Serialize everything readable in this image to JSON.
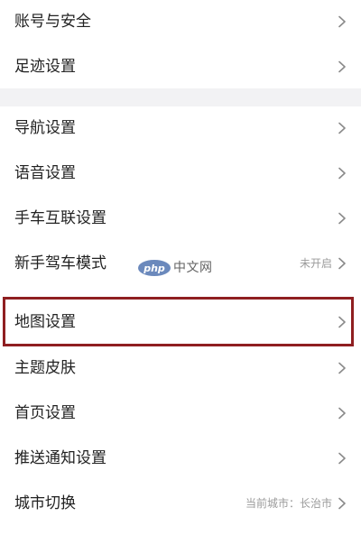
{
  "settings": {
    "group1": [
      {
        "label": "账号与安全",
        "value": ""
      },
      {
        "label": "足迹设置",
        "value": ""
      }
    ],
    "group2": [
      {
        "label": "导航设置",
        "value": ""
      },
      {
        "label": "语音设置",
        "value": ""
      },
      {
        "label": "手车互联设置",
        "value": ""
      },
      {
        "label": "新手驾车模式",
        "value": "未开启"
      },
      {
        "label": "地图设置",
        "value": ""
      },
      {
        "label": "主题皮肤",
        "value": ""
      },
      {
        "label": "首页设置",
        "value": ""
      },
      {
        "label": "推送通知设置",
        "value": ""
      },
      {
        "label": "城市切换",
        "value": "当前城市：长治市"
      }
    ]
  },
  "watermark": {
    "badge": "php",
    "text": "中文网"
  },
  "icons": {
    "row_chevron": "chevron-right-icon"
  },
  "colors": {
    "background": "#f2f2f4",
    "card": "#ffffff",
    "highlight_border": "#8f1f21",
    "label": "#222222",
    "secondary": "#9b9b9b"
  }
}
